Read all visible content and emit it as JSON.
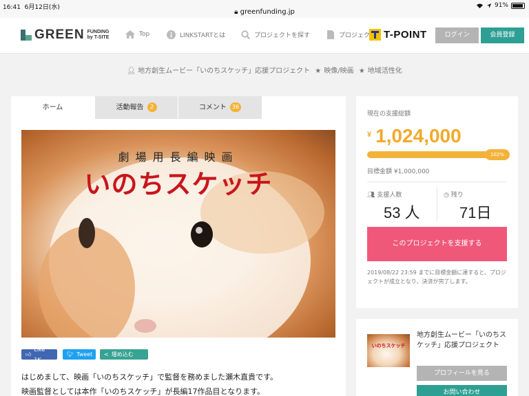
{
  "status_bar": {
    "time": "16:41",
    "date": "6月12日(水)",
    "url": "greenfunding.jp",
    "battery": "91%"
  },
  "header": {
    "logo_text": "GREEN",
    "logo_sub1": "FUNDING",
    "logo_sub2": "by T-SITE",
    "nav": [
      {
        "label": "Top",
        "icon": "home-icon"
      },
      {
        "label": "LINKSTARTとは",
        "icon": "info-icon"
      },
      {
        "label": "プロジェクトを探す",
        "icon": "search-icon"
      },
      {
        "label": "プロジェク",
        "icon": "document-icon"
      }
    ],
    "tpoint": "T-POINT",
    "login": "ログイン",
    "register": "会員登録"
  },
  "breadcrumb": {
    "project": "地方創生ムービー「いのちスケッチ」応援プロジェクト",
    "cat1": "映像/映画",
    "cat2": "地域活性化"
  },
  "tabs": [
    {
      "label": "ホーム"
    },
    {
      "label": "活動報告",
      "badge": "2"
    },
    {
      "label": "コメント",
      "badge": "36"
    }
  ],
  "hero": {
    "sub": "劇場用長編映画",
    "title": "いのちスケッチ"
  },
  "share": {
    "fb": "Like 1K",
    "tw": "Tweet",
    "embed": "埋め込む"
  },
  "body": [
    "はじめまして、映画「いのちスケッチ」で監督を務めました瀬木直貴です。",
    "映画監督としては本作「いのちスケッチ」が長編17作品目となります。"
  ],
  "funding": {
    "current_label": "現在の支援総額",
    "currency": "¥",
    "amount": "1,024,000",
    "progress": 102,
    "progress_label": "102%",
    "goal": "目標金額 ¥1,000,000",
    "supporters_label": "支援人数",
    "supporters": "53 人",
    "remaining_label": "残り",
    "remaining": "71日",
    "cta": "このプロジェクトを支援する",
    "note": "2019/08/22 23:59 までに目標金額に達すると、プロジェクトが成立となり、決済が完了します。"
  },
  "owner": {
    "thumb_text": "いのちスケッチ",
    "name": "地方創生ムービー「いのちスケッチ」応援プロジェクト",
    "profile": "プロフィールを見る",
    "contact": "お問い合わせ"
  },
  "colors": {
    "accent_green": "#2e9f93",
    "amount_orange": "#f1aa2a",
    "cta_pink": "#f0587a",
    "title_red": "#c8161d"
  }
}
